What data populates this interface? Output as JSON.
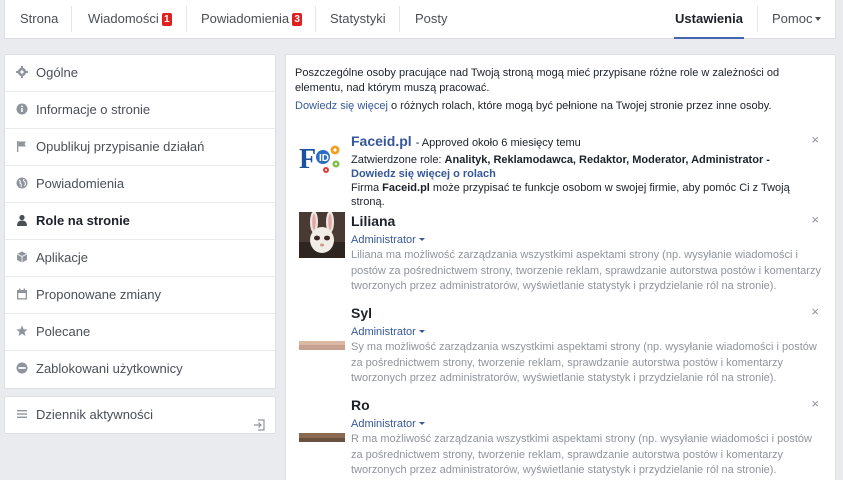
{
  "nav": {
    "strona": "Strona",
    "wiadomosci": "Wiadomości",
    "wiadomosci_badge": "1",
    "powiadomienia": "Powiadomienia",
    "powiadomienia_badge": "3",
    "statystyki": "Statystyki",
    "posty": "Posty",
    "ustawienia": "Ustawienia",
    "pomoc": "Pomoc"
  },
  "sidebar": {
    "items": [
      {
        "label": "Ogólne",
        "icon": "gear-icon"
      },
      {
        "label": "Informacje o stronie",
        "icon": "info-icon"
      },
      {
        "label": "Opublikuj przypisanie działań",
        "icon": "flag-icon"
      },
      {
        "label": "Powiadomienia",
        "icon": "globe-icon"
      },
      {
        "label": "Role na stronie",
        "icon": "person-icon"
      },
      {
        "label": "Aplikacje",
        "icon": "cube-icon"
      },
      {
        "label": "Proponowane zmiany",
        "icon": "calendar-icon"
      },
      {
        "label": "Polecane",
        "icon": "star-icon"
      },
      {
        "label": "Zablokowani użytkownicy",
        "icon": "block-icon"
      }
    ],
    "activity_log": "Dziennik aktywności"
  },
  "main": {
    "intro": "Poszczególne osoby pracujące nad Twoją stroną mogą mieć przypisane różne role w zależności od elementu, nad którym muszą pracować.",
    "learn_more_link": "Dowiedz się więcej",
    "learn_more_rest": " o różnych rolach, które mogą być pełnione na Twojej stronie przez inne osoby.",
    "entries": [
      {
        "name": "Faceid.pl",
        "meta": "- Approved około 6 miesięcy temu",
        "approved_label": "Zatwierdzone role: ",
        "approved_roles": "Analityk, Reklamodawca, Redaktor, Moderator, Administrator",
        "approved_dash": " -",
        "roles_link": "Dowiedz się więcej o rolach",
        "firm_prefix": "Firma ",
        "firm_name": "Faceid.pl",
        "firm_suffix": " może przypisać te funkcje osobom w swojej firmie, aby pomóc Ci z Twoją stroną."
      },
      {
        "name": "Liliana",
        "role": "Administrator",
        "desc_name": "Liliana",
        "desc": " ma możliwość zarządzania wszystkimi aspektami strony (np. wysyłanie wiadomości i postów za pośrednictwem strony, tworzenie reklam, sprawdzanie autorstwa postów i komentarzy tworzonych przez administratorów, wyświetlanie statystyk i przydzielanie ról na stronie)."
      },
      {
        "name": "Syl",
        "role": "Administrator",
        "desc_name": "Sy",
        "desc": " ma możliwość zarządzania wszystkimi aspektami strony (np. wysyłanie wiadomości i postów za pośrednictwem strony, tworzenie reklam, sprawdzanie autorstwa postów i komentarzy tworzonych przez administratorów, wyświetlanie statystyk i przydzielanie ról na stronie)."
      },
      {
        "name": "Ro",
        "role": "Administrator",
        "desc_name": "R",
        "desc": " ma możliwość zarządzania wszystkimi aspektami strony (np. wysyłanie wiadomości i postów za pośrednictwem strony, tworzenie reklam, sprawdzanie autorstwa postów i komentarzy tworzonych przez administratorów, wyświetlanie statystyk i przydzielanie ról na stronie)."
      }
    ],
    "close_glyph": "×"
  },
  "colors": {
    "accent": "#4267b2",
    "link": "#365899",
    "badge": "#e02020"
  }
}
